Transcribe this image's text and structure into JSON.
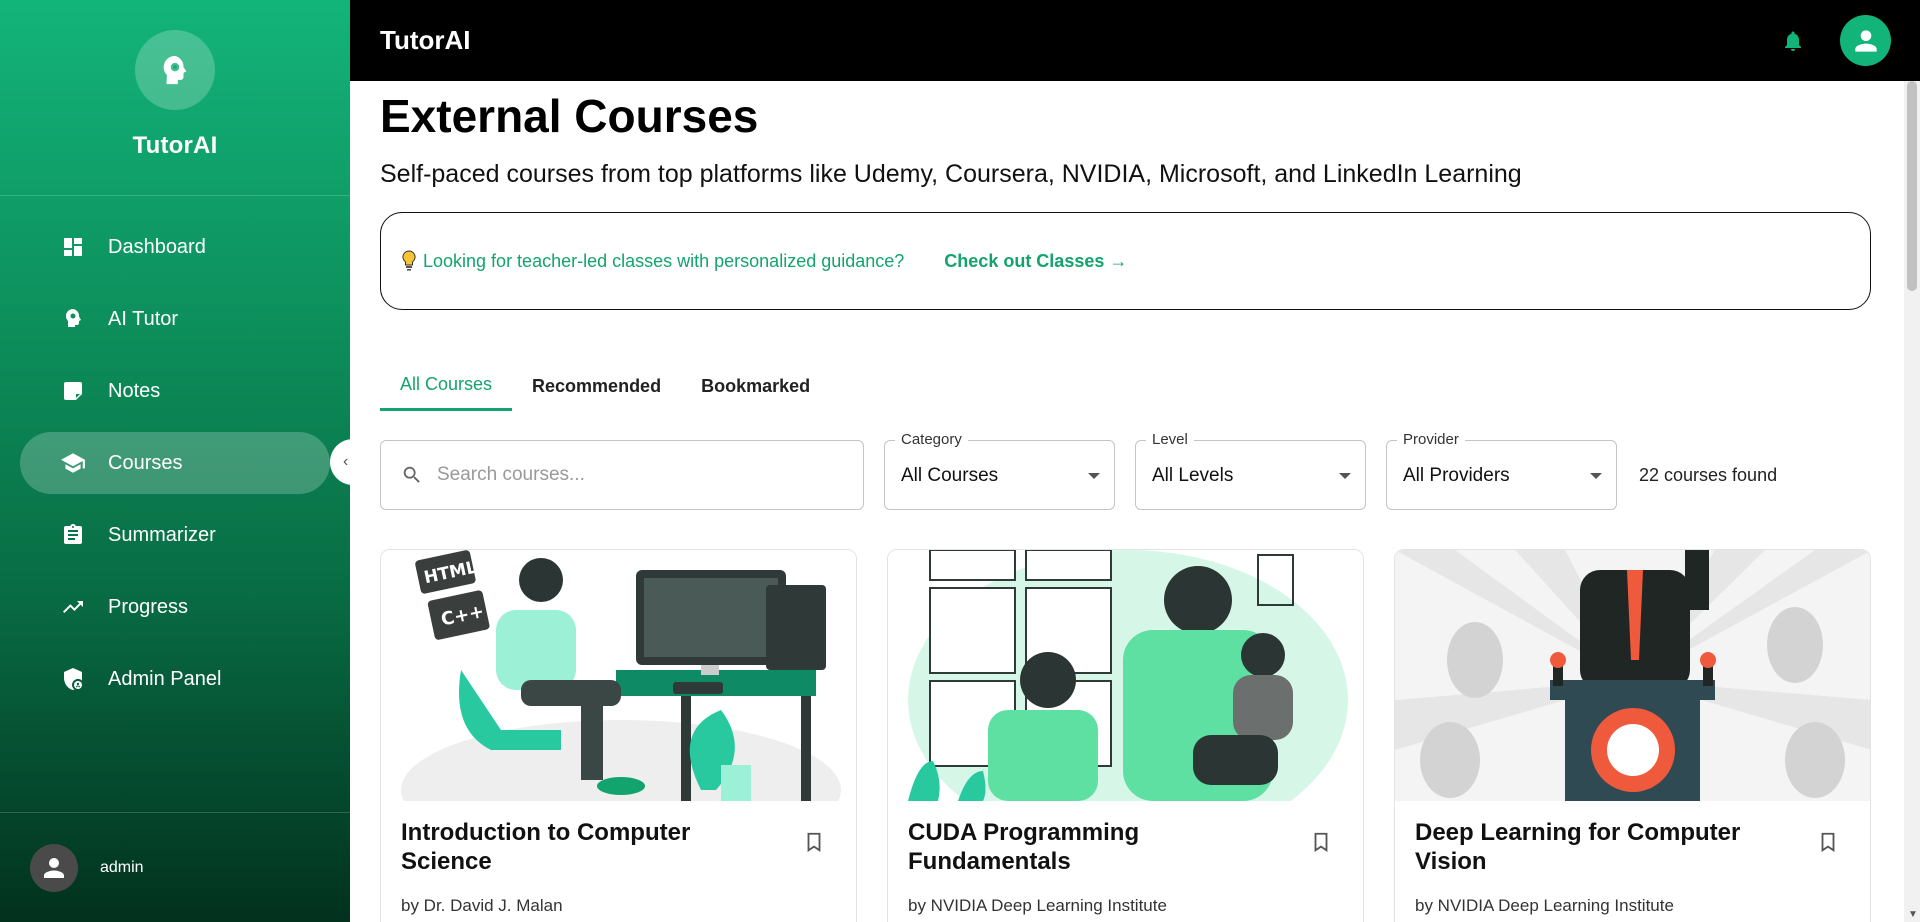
{
  "app": {
    "name": "TutorAI",
    "topbar_title": "TutorAI"
  },
  "sidebar": {
    "items": [
      {
        "label": "Dashboard",
        "icon": "dashboard-icon"
      },
      {
        "label": "AI Tutor",
        "icon": "brain-icon"
      },
      {
        "label": "Notes",
        "icon": "note-icon"
      },
      {
        "label": "Courses",
        "icon": "school-icon",
        "active": true
      },
      {
        "label": "Summarizer",
        "icon": "clipboard-icon"
      },
      {
        "label": "Progress",
        "icon": "trending-up-icon"
      },
      {
        "label": "Admin Panel",
        "icon": "admin-shield-icon"
      }
    ],
    "user": {
      "name": "admin"
    }
  },
  "header": {
    "title": "External Courses",
    "subtitle": "Self-paced courses from top platforms like Udemy, Coursera, NVIDIA, Microsoft, and LinkedIn Learning"
  },
  "banner": {
    "text": "Looking for teacher-led classes with personalized guidance?",
    "link": "Check out Classes →"
  },
  "tabs": [
    {
      "label": "All Courses",
      "active": true
    },
    {
      "label": "Recommended"
    },
    {
      "label": "Bookmarked"
    }
  ],
  "filters": {
    "search_placeholder": "Search courses...",
    "category": {
      "label": "Category",
      "value": "All Courses"
    },
    "level": {
      "label": "Level",
      "value": "All Levels"
    },
    "provider": {
      "label": "Provider",
      "value": "All Providers"
    },
    "count_text": "22 courses found"
  },
  "courses": [
    {
      "title": "Introduction to Computer Science",
      "author": "by Dr. David J. Malan",
      "illustration_text": [
        "HTML",
        "C++"
      ]
    },
    {
      "title": "CUDA Programming Fundamentals",
      "author": "by NVIDIA Deep Learning Institute"
    },
    {
      "title": "Deep Learning for Computer Vision",
      "author": "by NVIDIA Deep Learning Institute"
    }
  ],
  "colors": {
    "accent": "#13a46d",
    "topbar": "#000000",
    "sidebar_top": "#13b47a",
    "sidebar_bottom": "#02311e"
  }
}
